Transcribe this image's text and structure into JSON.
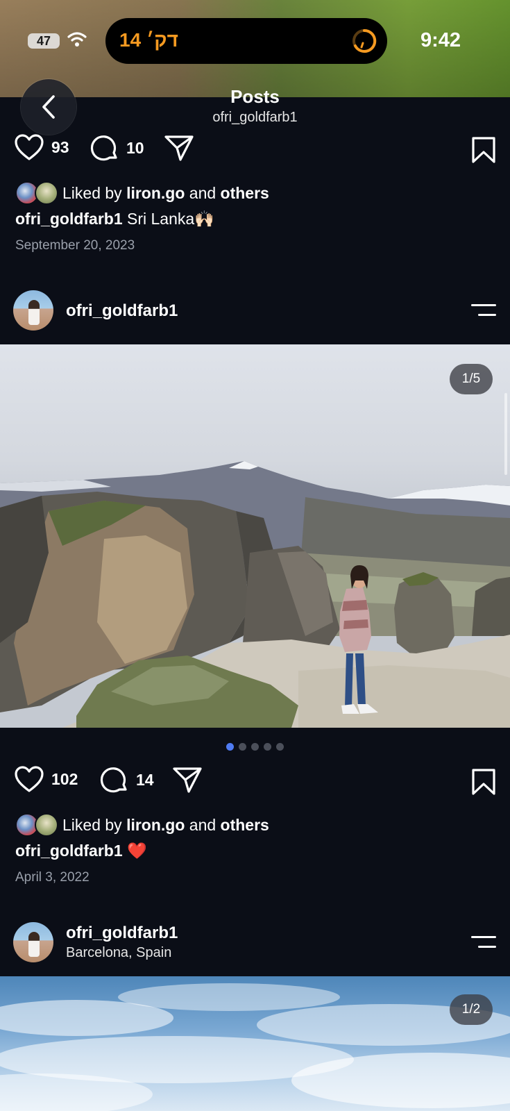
{
  "status_bar": {
    "battery": "47",
    "island_text": "14 דק׳",
    "time": "9:42"
  },
  "header": {
    "title": "Posts",
    "subtitle": "ofri_goldfarb1"
  },
  "post_top": {
    "likes": "93",
    "comments": "10",
    "liked_prefix": "Liked by ",
    "liked_user": "liron.go",
    "liked_and": " and ",
    "liked_others": "others",
    "caption_user": "ofri_goldfarb1",
    "caption_text": " Sri Lanka🙌🏻",
    "date": "September 20, 2023"
  },
  "post_2": {
    "username": "ofri_goldfarb1",
    "photo_counter": "1/5",
    "carousel": {
      "count": 5,
      "active": 1
    },
    "likes": "102",
    "comments": "14",
    "liked_prefix": "Liked by ",
    "liked_user": "liron.go",
    "liked_and": " and ",
    "liked_others": "others",
    "caption_user": "ofri_goldfarb1",
    "caption_text": " ❤️",
    "date": "April 3, 2022"
  },
  "post_3": {
    "username": "ofri_goldfarb1",
    "location": "Barcelona, Spain",
    "photo_counter": "1/2"
  },
  "colors": {
    "background": "#0b0e17",
    "accent_dot": "#4f7bf2",
    "island_text": "#f59a21"
  }
}
